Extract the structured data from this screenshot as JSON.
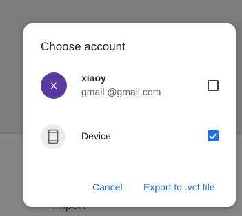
{
  "background": {
    "partial_text": "Import"
  },
  "dialog": {
    "title": "Choose account",
    "account": {
      "avatar_letter": "X",
      "avatar_color": "#5b3aa0",
      "name": "xiaoy",
      "email": "gmail  @gmail.com",
      "checked": false
    },
    "device": {
      "label": "Device",
      "icon": "phone-icon",
      "checked": true
    },
    "actions": {
      "cancel_label": "Cancel",
      "export_label": "Export to .vcf file"
    },
    "accent_color": "#1a73e8"
  }
}
